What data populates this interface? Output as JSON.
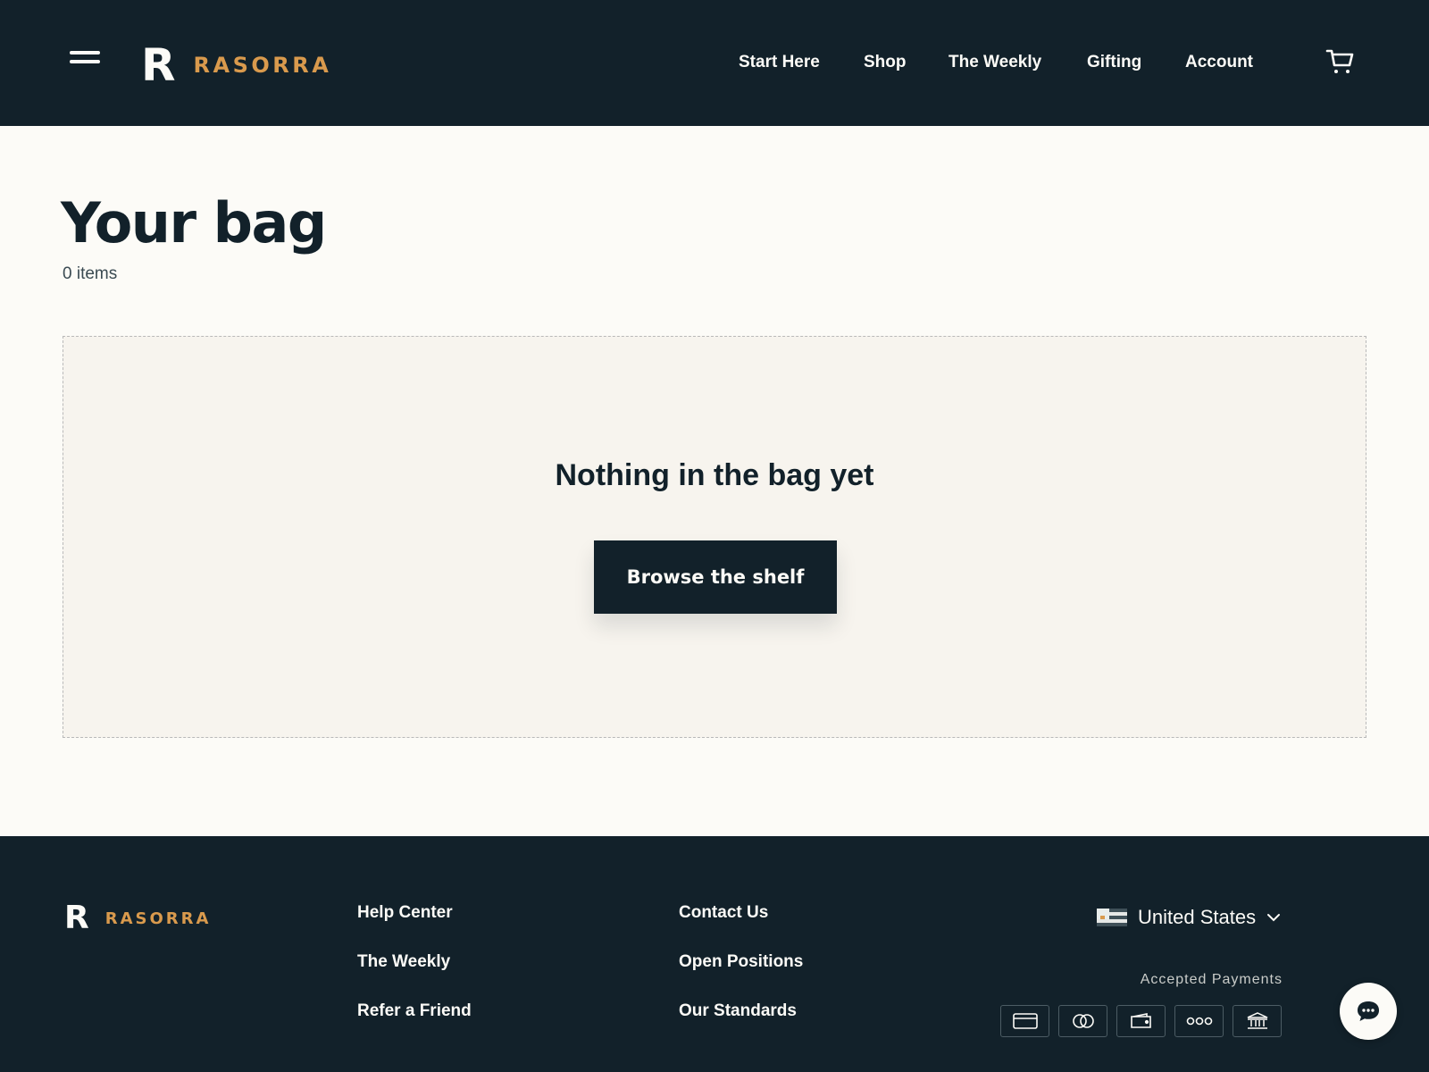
{
  "header": {
    "logo_letter": "R",
    "logo_word": "RASORRA",
    "nav": [
      {
        "label": "Start Here"
      },
      {
        "label": "Shop"
      },
      {
        "label": "The Weekly"
      },
      {
        "label": "Gifting"
      },
      {
        "label": "Account"
      }
    ],
    "icons": {
      "menu": "hamburger-icon",
      "cart": "cart-icon"
    }
  },
  "main": {
    "title": "Your bag",
    "item_count": "0 items",
    "empty_state": {
      "heading": "Nothing in the bag yet",
      "button_label": "Browse the shelf"
    }
  },
  "footer": {
    "logo_letter": "R",
    "logo_word": "RASORRA",
    "links_col1": [
      "Help Center",
      "The Weekly",
      "Refer a Friend"
    ],
    "links_col2": [
      "Contact Us",
      "Open Positions",
      "Our Standards"
    ],
    "country": "United States",
    "payments_label": "Accepted Payments",
    "payment_icons": [
      "credit-card-icon",
      "linked-circles-icon",
      "wallet-icon",
      "three-dots-icon",
      "bank-icon"
    ]
  },
  "colors": {
    "dark": "#12212a",
    "cream": "#fcfbf7",
    "accent": "#d99a4d",
    "panel": "#f7f4ee"
  }
}
